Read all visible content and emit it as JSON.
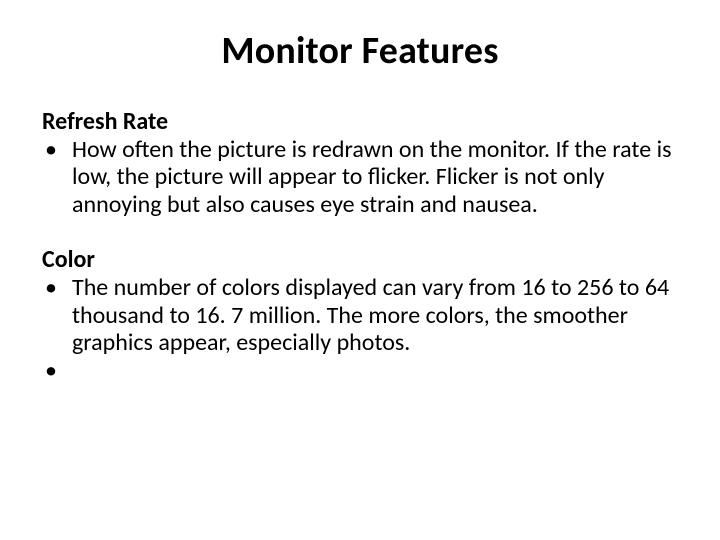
{
  "title": "Monitor Features",
  "sections": [
    {
      "heading": "Refresh Rate",
      "bullets": [
        "How often the picture is redrawn on the monitor. If the rate is low, the picture will appear to flicker. Flicker is not only annoying but also causes eye strain and nausea."
      ]
    },
    {
      "heading": "Color",
      "bullets": [
        "The number of colors displayed can vary from 16 to 256 to 64 thousand to 16. 7 million. The more colors, the smoother graphics appear, especially photos.",
        ""
      ]
    }
  ],
  "bullet_char": "•"
}
